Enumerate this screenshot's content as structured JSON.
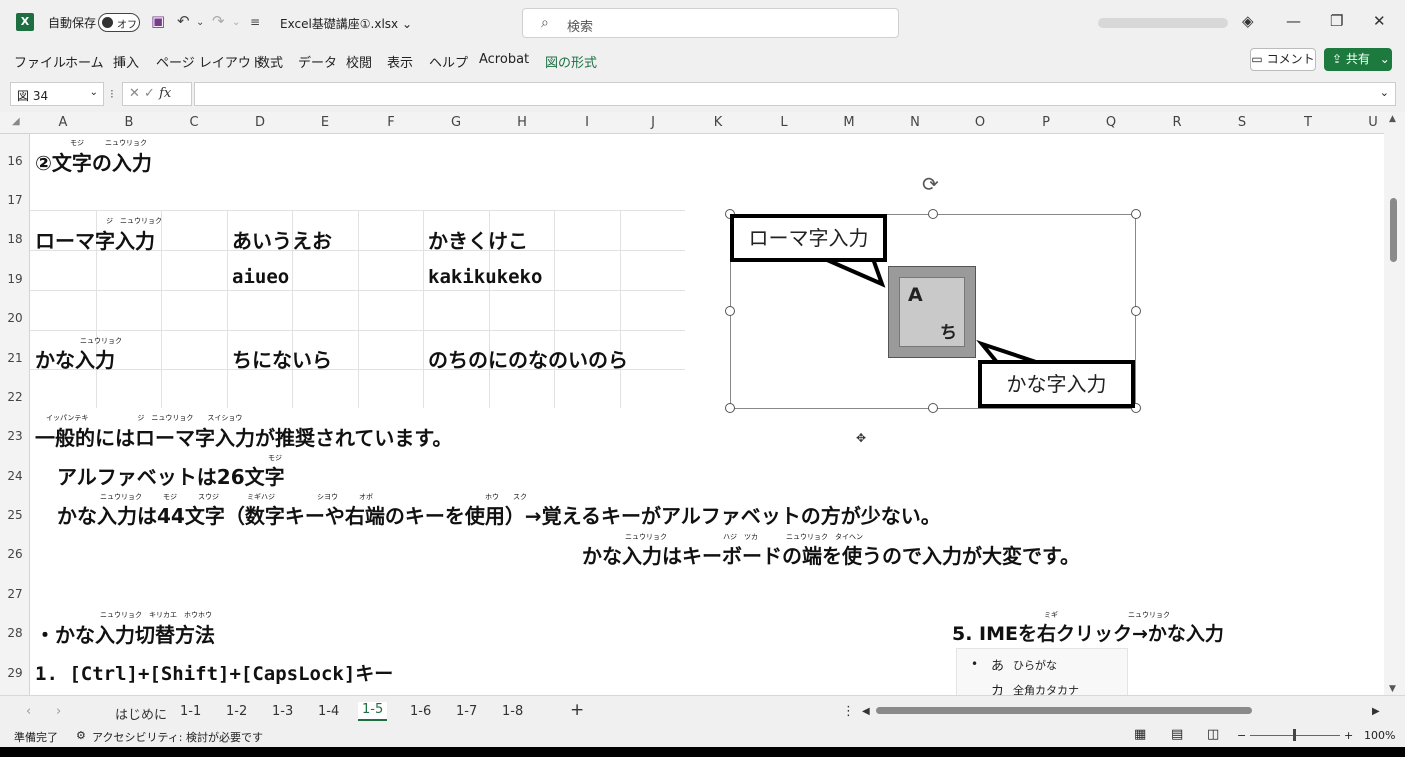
{
  "titlebar": {
    "logo": "X",
    "autosave_label": "自動保存",
    "autosave_state": "オフ",
    "filename": "Excel基礎講座①.xlsx",
    "search_placeholder": "検索"
  },
  "ribbon": {
    "tabs": [
      "ファイル",
      "ホーム",
      "挿入",
      "ページ レイアウト",
      "数式",
      "データ",
      "校閲",
      "表示",
      "ヘルプ",
      "Acrobat",
      "図の形式"
    ],
    "active_tab": "図の形式",
    "comment_label": "コメント",
    "share_label": "共有"
  },
  "formula_bar": {
    "name_box": "図 34",
    "fx_label": "fx",
    "formula": ""
  },
  "grid": {
    "columns": [
      "A",
      "B",
      "C",
      "D",
      "E",
      "F",
      "G",
      "H",
      "I",
      "J",
      "K",
      "L",
      "M",
      "N",
      "O",
      "P",
      "Q",
      "R",
      "S",
      "T",
      "U"
    ],
    "rows": [
      "16",
      "17",
      "18",
      "19",
      "20",
      "21",
      "22",
      "23",
      "24",
      "25",
      "26",
      "27",
      "28",
      "29"
    ]
  },
  "content": {
    "r16_title": "②文字の入力",
    "r16_furi": "モジ　　　ニュウリョク",
    "r18_a": "ローマ字入力",
    "r18_a_furi": "ジ　ニュウリョク",
    "r18_d": "あいうえお",
    "r18_g": "かきくけこ",
    "r19_d": "aiueo",
    "r19_g": "kakikukeko",
    "r21_a": "かな入力",
    "r21_a_furi": "ニュウリョク",
    "r21_d": "ちにないら",
    "r21_g": "のちのにのなのいのら",
    "r23": "一般的にはローマ字入力が推奨されています。",
    "r23_furi": "イッパンテキ　　　　　　　ジ　ニュウリョク　　スイショウ",
    "r24": "アルファベットは26文字",
    "r24_furi": "モジ",
    "r25": "かな入力は44文字（数字キーや右端のキーを使用）→覚えるキーがアルファベットの方が少ない。",
    "r25_furi": "ニュウリョク　　　モジ　　　スウジ　　　　ミギハジ　　　　　　シヨウ　　　オボ　　　　　　　　　　　　　　　　ホウ　　スク",
    "r26": "かな入力はキーボードの端を使うので入力が大変です。",
    "r26_furi": "ニュウリョク　　　　　　　　ハジ　ツカ　　　　ニュウリョク　タイヘン",
    "r28_a": "・かな入力切替方法",
    "r28_a_furi": "ニュウリョク　キリカエ　ホウホウ",
    "r28_n": "5. IMEを右クリック→かな入力",
    "r28_n_furi": "ミギ　　　　　　　　　　ニュウリョク",
    "r29": "1. [Ctrl]+[Shift]+[CapsLock]キー"
  },
  "shape": {
    "callout_roman": "ローマ字入力",
    "callout_kana": "かな字入力",
    "key_letter": "A",
    "key_kana": "ち"
  },
  "ime_menu": {
    "items": [
      {
        "mark": "•",
        "glyph": "あ",
        "label": "ひらがな"
      },
      {
        "mark": "",
        "glyph": "カ",
        "label": "全角カタカナ"
      }
    ]
  },
  "sheet_tabs": {
    "tabs": [
      "はじめに",
      "1-1",
      "1-2",
      "1-3",
      "1-4",
      "1-5",
      "1-6",
      "1-7",
      "1-8"
    ],
    "active": "1-5"
  },
  "status": {
    "ready": "準備完了",
    "accessibility": "アクセシビリティ: 検討が必要です",
    "zoom": "100%"
  }
}
